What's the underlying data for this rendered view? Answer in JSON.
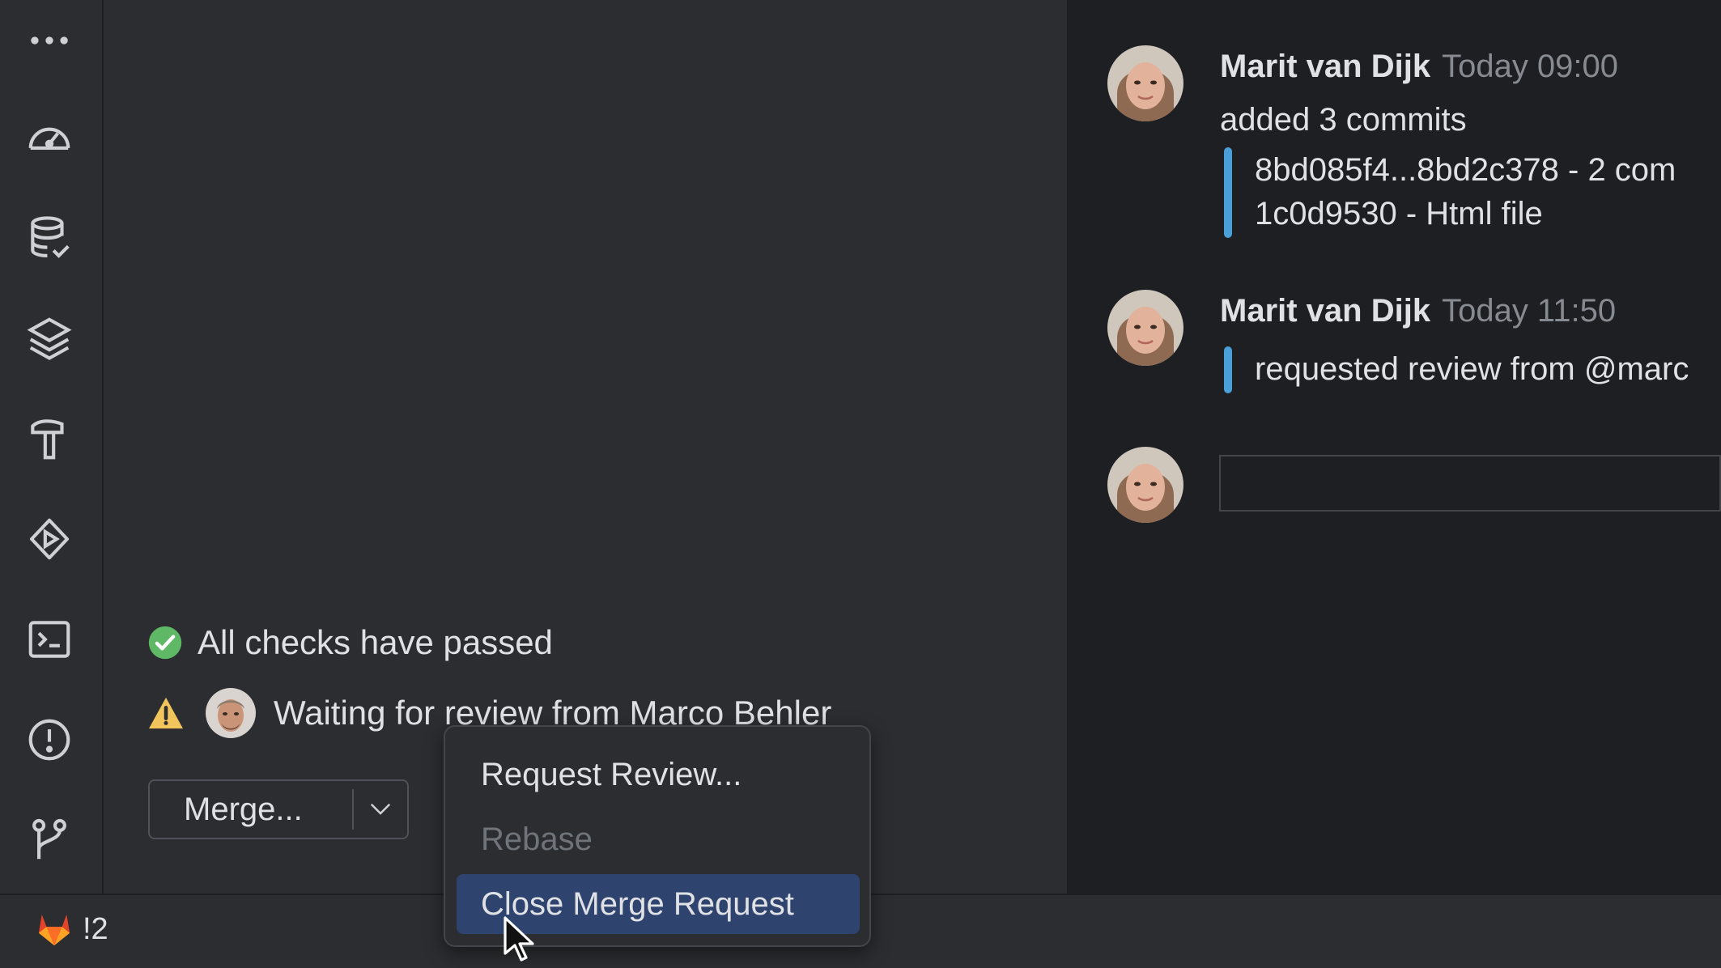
{
  "sidebar": {
    "icons": [
      "more-icon",
      "dashboard-icon",
      "database-check-icon",
      "layers-icon",
      "build-hammer-icon",
      "run-icon",
      "terminal-icon",
      "problems-icon",
      "git-branch-icon"
    ]
  },
  "checks": {
    "status_text": "All checks have passed",
    "review_text": "Waiting for review from Marco Behler",
    "status_color": "#5fb865",
    "warning_color": "#f2c55c"
  },
  "merge_button": {
    "label": "Merge..."
  },
  "menu": {
    "items": [
      {
        "label": "Request Review...",
        "state": "enabled"
      },
      {
        "label": "Rebase",
        "state": "disabled"
      },
      {
        "label": "Close Merge Request",
        "state": "selected"
      }
    ]
  },
  "timeline": {
    "events": [
      {
        "author": "Marit van Dijk",
        "time": "Today 09:00",
        "text": "added 3 commits",
        "commits": [
          "8bd085f4...8bd2c378 - 2 com",
          "1c0d9530 - Html file"
        ]
      },
      {
        "author": "Marit van Dijk",
        "time": "Today 11:50",
        "text": "requested review from @marc"
      }
    ]
  },
  "statusbar": {
    "mr_count": "!2"
  },
  "colors": {
    "accent": "#3574f0",
    "selection": "#2e436e",
    "timeline_bar": "#4a9fd8"
  }
}
